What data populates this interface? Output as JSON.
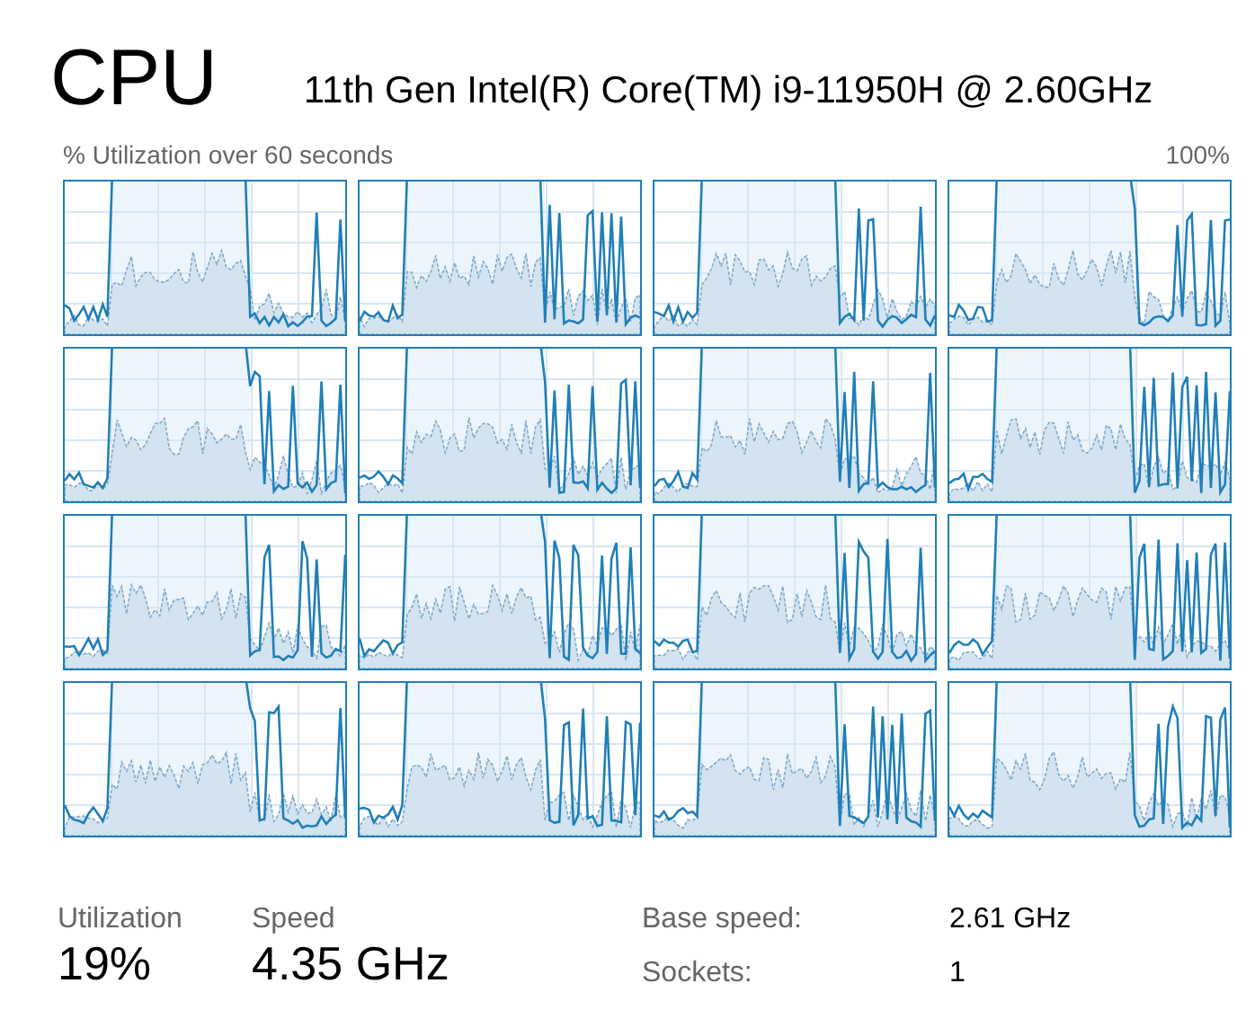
{
  "title": "CPU",
  "processor": "11th Gen Intel(R) Core(TM) i9-11950H @ 2.60GHz",
  "graph_caption": "% Utilization over 60 seconds",
  "graph_max": "100%",
  "core_graphs": [
    {
      "kind": "sparkline"
    },
    {
      "kind": "sparkline"
    },
    {
      "kind": "sparkline"
    },
    {
      "kind": "sparkline"
    },
    {
      "kind": "sparkline"
    },
    {
      "kind": "sparkline"
    },
    {
      "kind": "sparkline"
    },
    {
      "kind": "sparkline"
    },
    {
      "kind": "sparkline"
    },
    {
      "kind": "sparkline"
    },
    {
      "kind": "sparkline"
    },
    {
      "kind": "sparkline"
    },
    {
      "kind": "sparkline"
    },
    {
      "kind": "sparkline"
    },
    {
      "kind": "sparkline"
    },
    {
      "kind": "sparkline"
    }
  ],
  "main_stats": [
    {
      "label": "Utilization",
      "value": "19%"
    },
    {
      "label": "Speed",
      "value": "4.35 GHz"
    }
  ],
  "details": [
    {
      "label": "Base speed:",
      "value": "2.61 GHz"
    },
    {
      "label": "Sockets:",
      "value": "1"
    }
  ]
}
